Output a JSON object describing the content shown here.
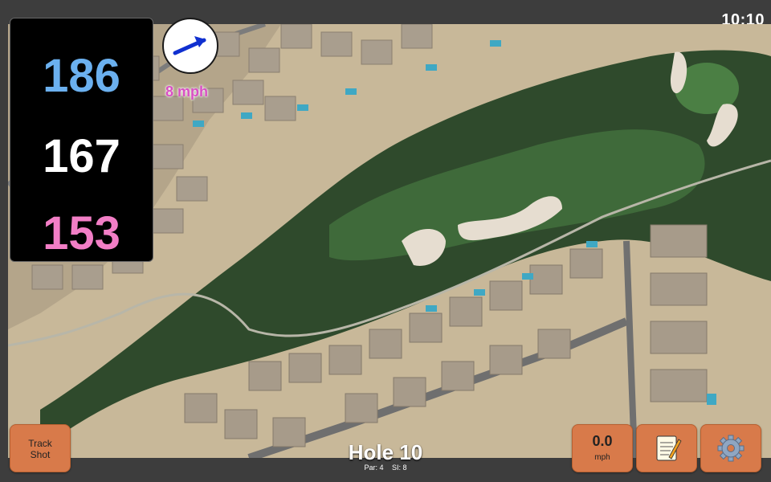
{
  "status": {
    "clock": "10:10"
  },
  "distances": {
    "back": "186",
    "middle": "167",
    "front": "153"
  },
  "wind": {
    "speed": "8 mph",
    "icon": "arrow-up-right-icon"
  },
  "hole": {
    "title": "Hole 10",
    "par": "Par: 4",
    "si": "SI: 8"
  },
  "buttons": {
    "track_shot": [
      "Track",
      "Shot"
    ],
    "shot_speed_value": "0.0",
    "shot_speed_unit": "mph",
    "notes_icon": "notepad-icon",
    "settings_icon": "gear-icon"
  },
  "colors": {
    "back_distance": "#6bb0ef",
    "middle_distance": "#ffffff",
    "front_distance": "#f27ec6",
    "wind_speed": "#d94fc4",
    "button_accent": "#d87a4a"
  }
}
